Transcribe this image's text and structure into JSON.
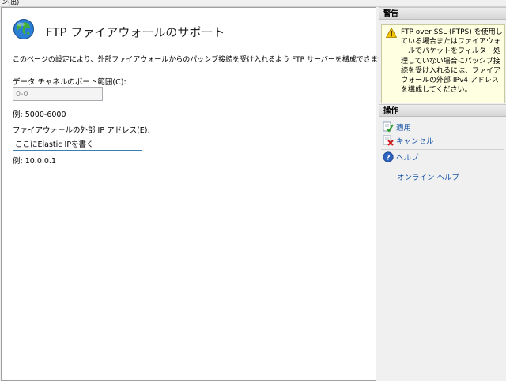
{
  "top_strip_text": "ン(出)",
  "page": {
    "title": "FTP ファイアウォールのサポート",
    "description": "このページの設定により、外部ファイアウォールからのパッシブ接続を受け入れるよう FTP サーバーを構成できます。",
    "port_range": {
      "label": "データ チャネルのポート範囲(C):",
      "value": "0-0",
      "example": "例: 5000-6000"
    },
    "external_ip": {
      "label": "ファイアウォールの外部 IP アドレス(E):",
      "value": "ここにElastic IPを書く",
      "example": "例: 10.0.0.1"
    }
  },
  "sidebar": {
    "alerts": {
      "header": "警告",
      "message": "FTP over SSL (FTPS) を使用している場合またはファイアウォールでパケットをフィルター処理していない場合にパッシブ接続を受け入れるには、ファイアウォールの外部 IPv4 アドレスを構成してください。"
    },
    "actions": {
      "header": "操作",
      "apply": "適用",
      "cancel": "キャンセル",
      "help": "ヘルプ",
      "online_help": "オンライン ヘルプ"
    }
  },
  "colors": {
    "link": "#1a56a8",
    "warning_bg": "#ffffe1"
  }
}
